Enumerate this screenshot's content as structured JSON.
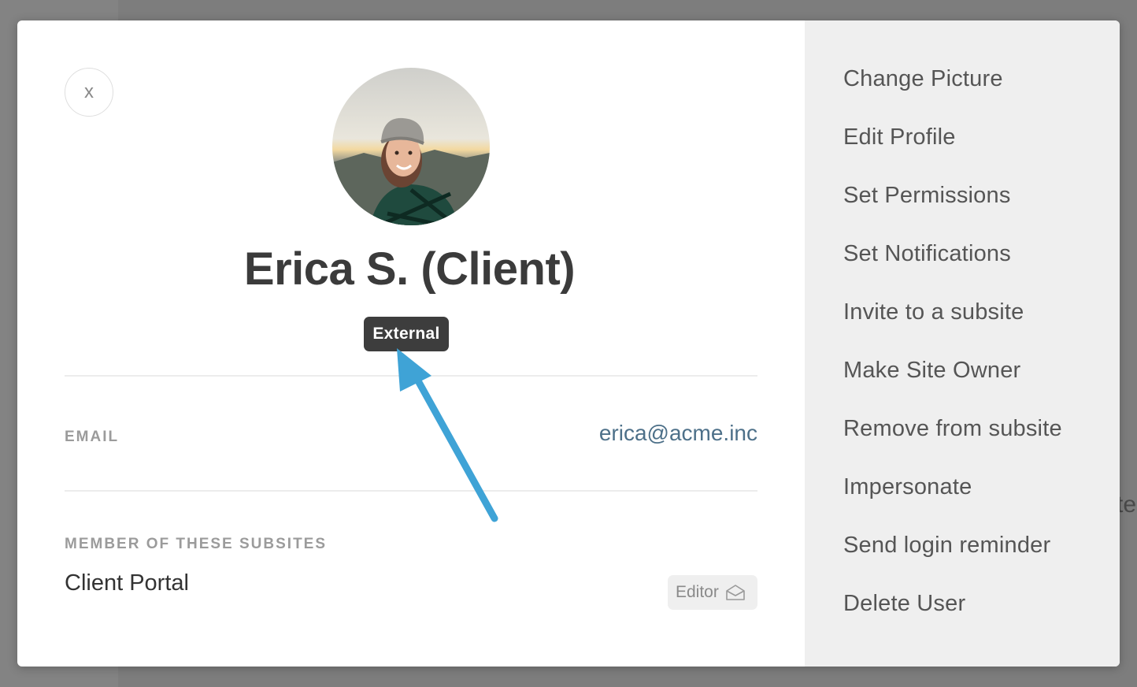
{
  "backdrop": {
    "peek_text": "te"
  },
  "profile": {
    "close_label": "x",
    "name": "Erica S. (Client)",
    "badge": "External"
  },
  "email": {
    "label": "EMAIL",
    "value": "erica@acme.inc"
  },
  "subsites": {
    "label": "MEMBER OF THESE SUBSITES",
    "items": [
      {
        "name": "Client Portal",
        "role": "Editor",
        "role_icon": "envelope-open-icon"
      }
    ]
  },
  "actions": [
    "Change Picture",
    "Edit Profile",
    "Set Permissions",
    "Set Notifications",
    "Invite to a subsite",
    "Make Site Owner",
    "Remove from subsite",
    "Impersonate",
    "Send login reminder",
    "Delete User"
  ],
  "colors": {
    "accent_link": "#4d7089",
    "badge_bg": "#3d3d3d",
    "annotation_arrow": "#3fa3d6",
    "side_panel_bg": "#efefef"
  }
}
